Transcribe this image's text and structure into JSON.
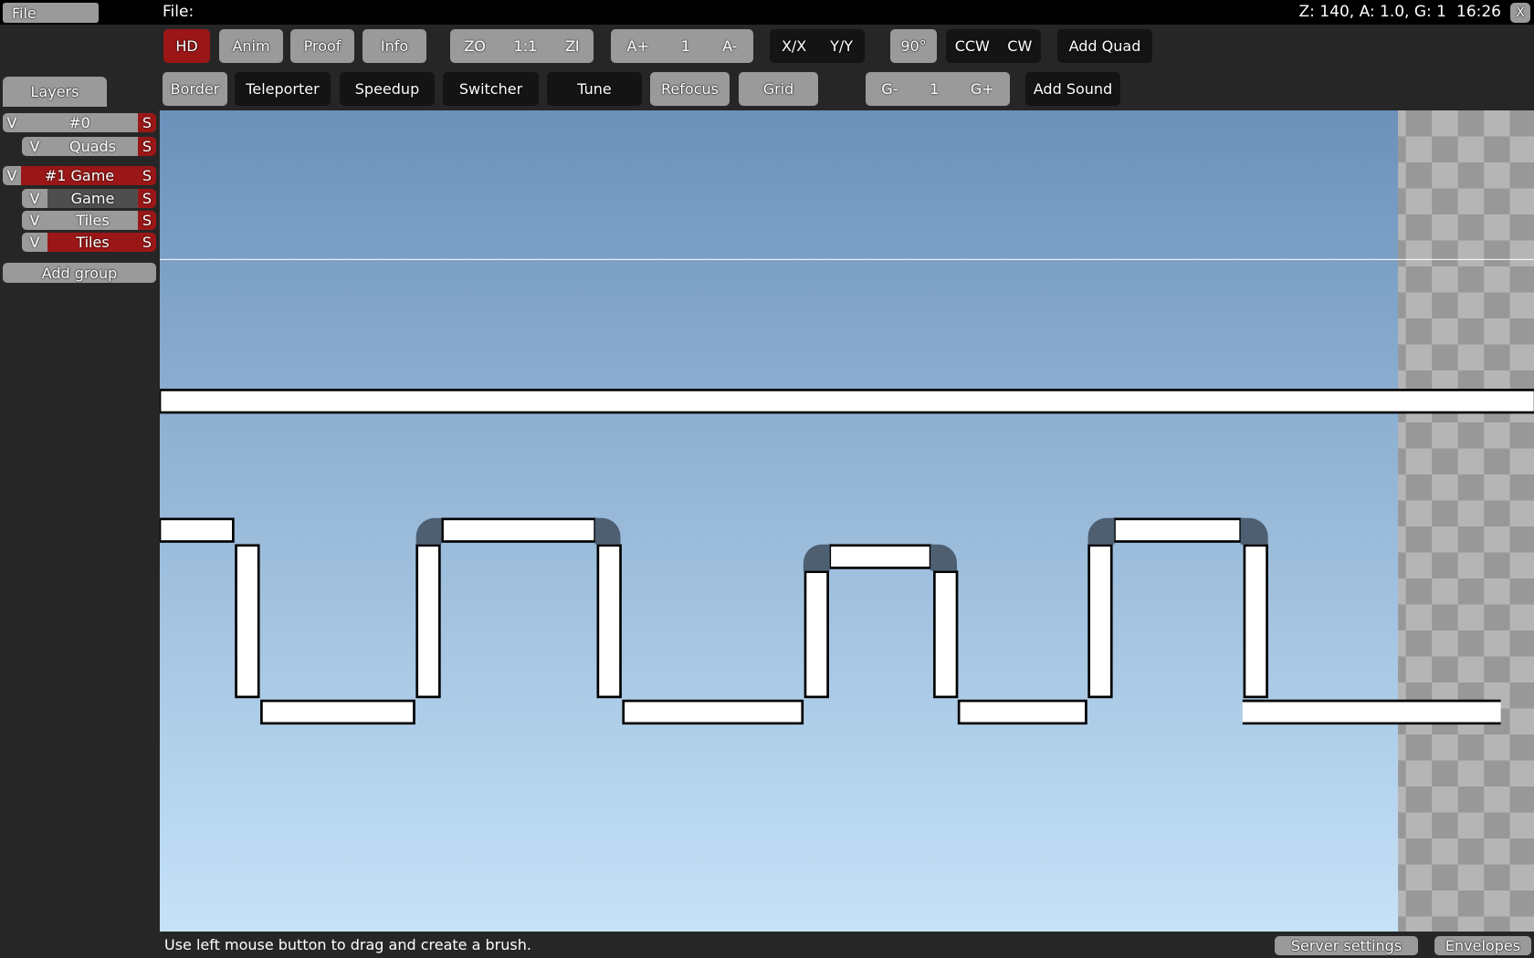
{
  "menubar": {
    "file_label": "File",
    "file_title": "File:",
    "status": "Z: 140, A: 1.0, G: 1",
    "time": "16:26",
    "close_label": "X"
  },
  "toolbar": {
    "row1": {
      "hd": "HD",
      "anim": "Anim",
      "proof": "Proof",
      "info": "Info",
      "zoom_out": "ZO",
      "zoom_reset": "1:1",
      "zoom_in": "ZI",
      "anim_up": "A+",
      "anim_value": "1",
      "anim_down": "A-",
      "flip_x": "X/X",
      "flip_y": "Y/Y",
      "rotate_angle": "90°",
      "ccw": "CCW",
      "cw": "CW",
      "add_quad": "Add Quad"
    },
    "row2": {
      "border": "Border",
      "teleporter": "Teleporter",
      "speedup": "Speedup",
      "switcher": "Switcher",
      "tune": "Tune",
      "refocus": "Refocus",
      "grid": "Grid",
      "grid_down": "G-",
      "grid_value": "1",
      "grid_up": "G+",
      "add_sound": "Add Sound"
    }
  },
  "sidebar": {
    "tab": "Layers",
    "items": [
      {
        "v": "V",
        "name": "#0",
        "s": "S"
      },
      {
        "v": "V",
        "name": "Quads",
        "s": "S"
      },
      {
        "v": "V",
        "name": "#1 Game",
        "s": "S"
      },
      {
        "v": "V",
        "name": "Game",
        "s": "S"
      },
      {
        "v": "V",
        "name": "Tiles",
        "s": "S"
      },
      {
        "v": "V",
        "name": "Tiles",
        "s": "S"
      }
    ],
    "add_group": "Add group"
  },
  "colors": {
    "accent_red": "#9b1717",
    "button_gray": "#9a9a9a",
    "sky_top": "#6c91ba",
    "sky_bottom": "#c5e2f8"
  },
  "statusbar": {
    "hint": "Use left mouse button to drag and create a brush.",
    "server_settings": "Server settings",
    "envelopes": "Envelopes"
  }
}
